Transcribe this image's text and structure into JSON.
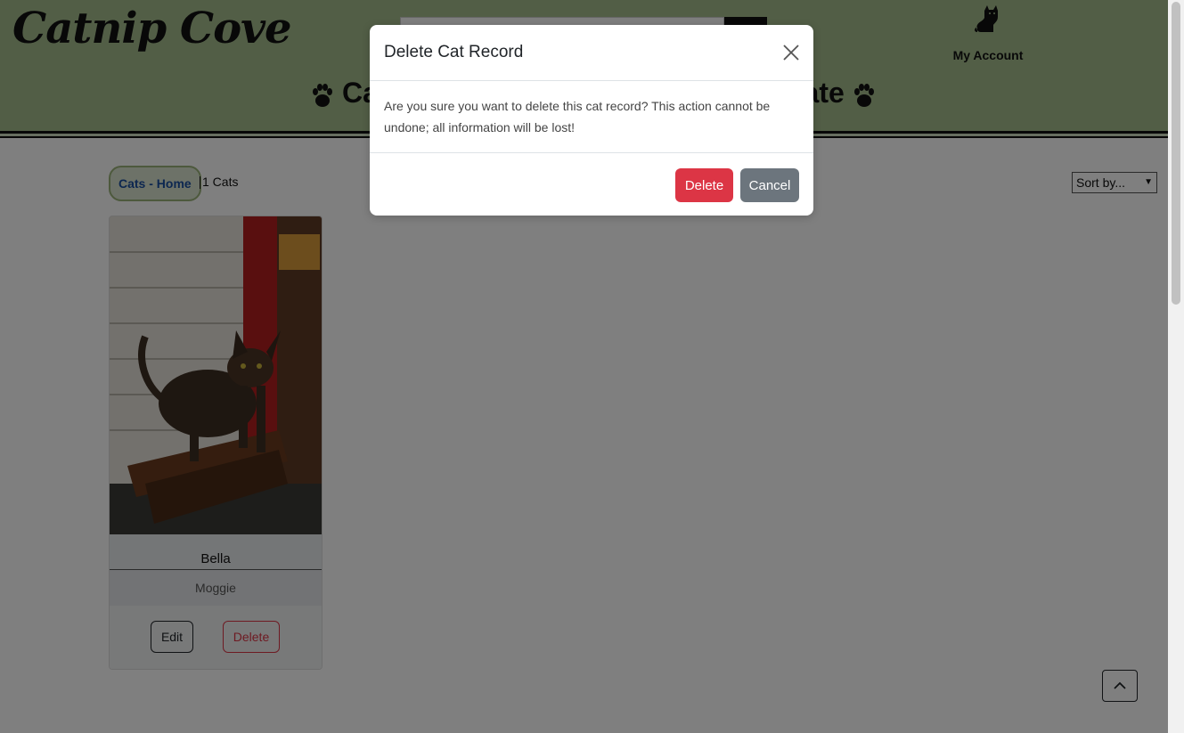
{
  "header": {
    "logo_text": "Catnip Cove",
    "account_label": "My Account",
    "nav_left_fragment": "Ca",
    "nav_right_fragment": "nate"
  },
  "toolbar": {
    "breadcrumb": "Cats - Home",
    "count": "1 Cats",
    "sort_selected": "Sort by..."
  },
  "cards": [
    {
      "name": "Bella",
      "breed": "Moggie",
      "edit_label": "Edit",
      "delete_label": "Delete"
    }
  ],
  "modal": {
    "title": "Delete Cat Record",
    "body": "Are you sure you want to delete this cat record? This action cannot be undone; all information will be lost!",
    "delete_label": "Delete",
    "cancel_label": "Cancel"
  },
  "colors": {
    "header_bg": "#a4bd8d",
    "danger": "#dc3545",
    "secondary": "#6c757d",
    "link": "#1a4ea0"
  }
}
